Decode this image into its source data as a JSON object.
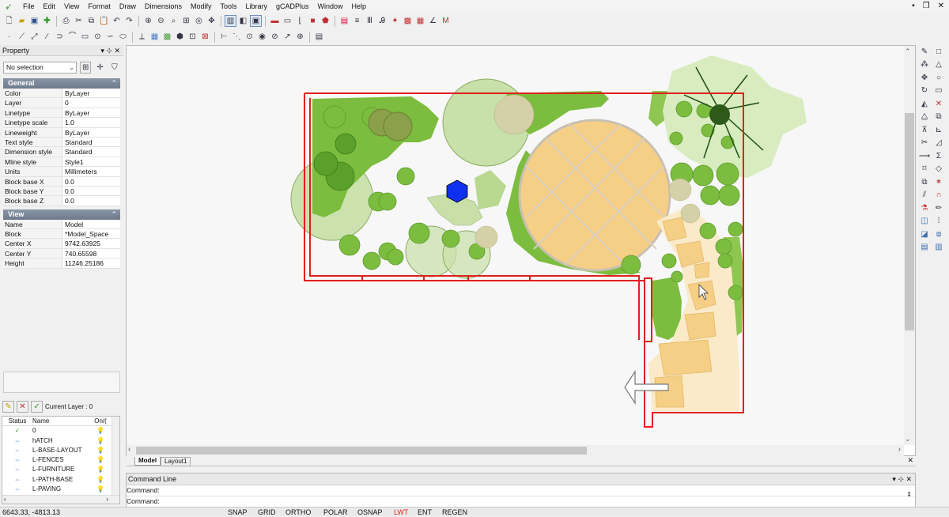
{
  "menu": [
    "File",
    "Edit",
    "View",
    "Format",
    "Draw",
    "Dimensions",
    "Modify",
    "Tools",
    "Library",
    "gCADPlus",
    "Window",
    "Help"
  ],
  "toolbar1": [
    "new-icon",
    "open-icon",
    "save-icon",
    "add-icon",
    "print-icon",
    "cut-icon",
    "copy-icon",
    "paste-icon",
    "undo-icon",
    "redo-icon",
    "zoom-in-icon",
    "zoom-out-icon",
    "zoom-window-icon",
    "zoom-extents-icon",
    "zoom-realtime-icon",
    "pan-icon",
    "layout-icon",
    "view-icon",
    "display-icon",
    "layer-icon",
    "layout-tab-icon",
    "book-icon",
    "frame-icon",
    "stop-icon",
    "tag-icon",
    "color-icon",
    "lineweight-icon",
    "linetype-icon",
    "tools-icon",
    "pt-icon",
    "hatch-icon",
    "lib-icon",
    "text-icon",
    "m-icon"
  ],
  "toolbar2": [
    "point-icon",
    "line-icon",
    "xline-icon",
    "ray-icon",
    "polyline-icon",
    "arc-icon",
    "rectangle-icon",
    "circle-icon",
    "spline-icon",
    "ellipse-icon",
    "dim-icon",
    "insert-icon",
    "block-icon",
    "table-icon",
    "hatch-icon",
    "grid-icon",
    "dim-linear-icon",
    "dim-aligned-icon",
    "dim-angle-icon",
    "dim-radius-icon",
    "dim-diameter-icon",
    "leader-icon",
    "center-icon",
    "list-icon"
  ],
  "property": {
    "title": "Property",
    "selection": "No selection",
    "general_label": "General",
    "general": [
      {
        "k": "Color",
        "v": "ByLayer"
      },
      {
        "k": "Layer",
        "v": "0"
      },
      {
        "k": "Linetype",
        "v": "ByLayer"
      },
      {
        "k": "Linetype scale",
        "v": "1.0"
      },
      {
        "k": "Lineweight",
        "v": "ByLayer"
      },
      {
        "k": "Text style",
        "v": "Standard"
      },
      {
        "k": "Dimension style",
        "v": "Standard"
      },
      {
        "k": "Mline style",
        "v": "Style1"
      },
      {
        "k": "Units",
        "v": "Millimeters"
      },
      {
        "k": "Block base X",
        "v": "0.0"
      },
      {
        "k": "Block base Y",
        "v": "0.0"
      },
      {
        "k": "Block base Z",
        "v": "0.0"
      }
    ],
    "view_label": "View",
    "view": [
      {
        "k": "Name",
        "v": "Model"
      },
      {
        "k": "Block",
        "v": "*Model_Space"
      },
      {
        "k": "Center X",
        "v": "9742.63925"
      },
      {
        "k": "Center Y",
        "v": "740.65598"
      },
      {
        "k": "Height",
        "v": "11246.25186"
      }
    ]
  },
  "layers": {
    "current_label": "Current Layer : 0",
    "headers": {
      "status": "Status",
      "name": "Name",
      "on": "On/("
    },
    "rows": [
      {
        "status": "✓",
        "name": "0"
      },
      {
        "status": "⇔",
        "name": "hATCH"
      },
      {
        "status": "⇔",
        "name": "L-BASE-LAYOUT"
      },
      {
        "status": "⇔",
        "name": "L-FENCES"
      },
      {
        "status": "⇔",
        "name": "L-FURNITURE"
      },
      {
        "status": "⇔",
        "name": "L-PATH-BASE"
      },
      {
        "status": "⇔",
        "name": "L-PAVING"
      }
    ]
  },
  "tabs": {
    "model": "Model",
    "layout1": "Layout1"
  },
  "command": {
    "title": "Command Line",
    "line1": "Command:",
    "line2": "Command:"
  },
  "status": {
    "coords": "6643.33,  -4813.13",
    "buttons": [
      "SNAP",
      "GRID",
      "ORTHO",
      "POLAR",
      "OSNAP",
      "LWT",
      "ENT",
      "REGEN"
    ]
  },
  "right_tools": [
    "brush-icon",
    "square-icon",
    "node-icon",
    "triangle-icon",
    "move-icon",
    "circle-icon",
    "rotate-icon",
    "rect-icon",
    "mirror-icon",
    "cross-icon",
    "triangle2-icon",
    "copy-icon",
    "pin-icon",
    "chart-icon",
    "trim-icon",
    "chamfer-icon",
    "extend-icon",
    "sigma-icon",
    "break-icon",
    "diamond-icon",
    "stretch-icon",
    "explode-icon",
    "offset-icon",
    "magnet-icon",
    "flask-icon",
    "pencil-icon",
    "layer-up-icon",
    "grid-icon",
    "layer-dn-icon",
    "layers-icon",
    "stack-icon",
    "stack2-icon"
  ],
  "colors": {
    "wall": "#e0201d",
    "accent": "#6f8fb5",
    "paving": "#f6cf86",
    "tree": "#7cbd3f",
    "hex": "#1030f0"
  }
}
